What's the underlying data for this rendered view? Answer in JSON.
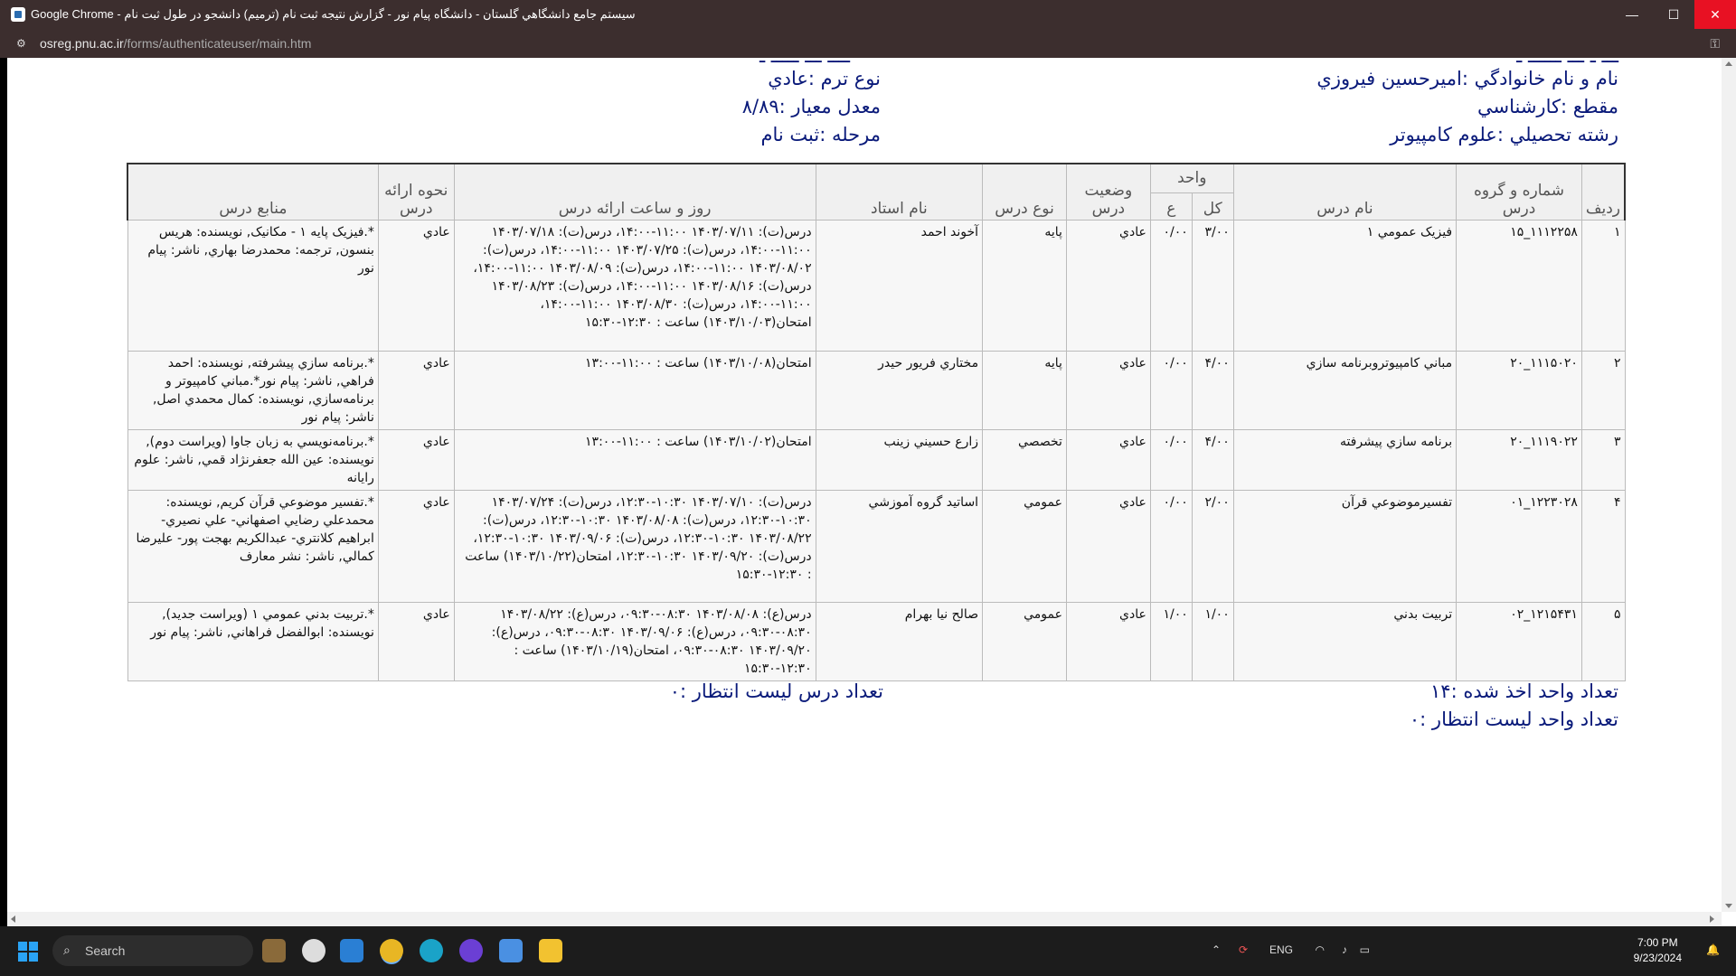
{
  "window": {
    "title": "Google Chrome - سيستم جامع دانشگاهي گلستان - دانشگاه پيام نور - گزارش نتيجه ثبت نام (ترميم) دانشجو در طول ثبت نام",
    "controls": {
      "minimize": "—",
      "maximize": "☐",
      "close": "✕"
    }
  },
  "address": {
    "domain": "osreg.pnu.ac.ir",
    "path": "/forms/authenticateuser/main.htm"
  },
  "student": {
    "name": "نام و نام خانوادگي :اميرحسين فيروزي",
    "level": "مقطع :کارشناسي",
    "major": "رشته تحصيلي :علوم کامپيوتر",
    "term_type": "نوع ترم :عادي",
    "gpa": "معدل معيار :۸/۸۹",
    "stage": "مرحله :ثبت نام"
  },
  "table": {
    "headers": {
      "row": "رديف",
      "code": "شماره و گروه درس",
      "name": "نام درس",
      "unit": "واحد",
      "unit_total": "کل",
      "unit_practical": "ع",
      "status": "وضعيت درس",
      "type": "نوع درس",
      "teacher": "نام استاد",
      "schedule": "روز و ساعت ارائه درس",
      "delivery": "نحوه ارائه درس",
      "sources": "منابع درس"
    },
    "rows": [
      {
        "row": "۱",
        "code": "۱۱۱۲۲۵۸_۱۵",
        "name": "فيزيک عمومي ۱",
        "unit_total": "۳/۰۰",
        "unit_practical": "۰/۰۰",
        "status": "عادي",
        "type": "پايه",
        "teacher": "آخوند احمد",
        "schedule": "درس(ت): ۱۴۰۳/۰۷/۱۱ ۱۱:۰۰-۱۴:۰۰، درس(ت): ۱۴۰۳/۰۷/۱۸ ۱۱:۰۰-۱۴:۰۰، درس(ت): ۱۴۰۳/۰۷/۲۵ ۱۱:۰۰-۱۴:۰۰، درس(ت): ۱۴۰۳/۰۸/۰۲ ۱۱:۰۰-۱۴:۰۰، درس(ت): ۱۴۰۳/۰۸/۰۹ ۱۱:۰۰-۱۴:۰۰، درس(ت): ۱۴۰۳/۰۸/۱۶ ۱۱:۰۰-۱۴:۰۰، درس(ت): ۱۴۰۳/۰۸/۲۳ ۱۱:۰۰-۱۴:۰۰، درس(ت): ۱۴۰۳/۰۸/۳۰ ۱۱:۰۰-۱۴:۰۰، امتحان(۱۴۰۳/۱۰/۰۳) ساعت : ۱۲:۳۰-۱۵:۳۰",
        "delivery": "عادي",
        "sources": "*.فيزيک پايه ۱ - مکانيک, نويسنده: هريس بنسون, ترجمه: محمدرضا بهاري, ناشر: پيام نور"
      },
      {
        "row": "۲",
        "code": "۱۱۱۵۰۲۰_۲۰",
        "name": "مباني کامپيوتروبرنامه سازي",
        "unit_total": "۴/۰۰",
        "unit_practical": "۰/۰۰",
        "status": "عادي",
        "type": "پايه",
        "teacher": "مختاري فريور حيدر",
        "schedule": "امتحان(۱۴۰۳/۱۰/۰۸) ساعت : ۱۱:۰۰-۱۳:۰۰",
        "delivery": "عادي",
        "sources": "*.برنامه سازي پيشرفته, نويسنده: احمد فراهي, ناشر: پيام نور*.مباني کامپيوتر و برنامه‌سازي, نويسنده: کمال محمدي اصل, ناشر: پيام نور"
      },
      {
        "row": "۳",
        "code": "۱۱۱۹۰۲۲_۲۰",
        "name": "برنامه سازي پيشرفته",
        "unit_total": "۴/۰۰",
        "unit_practical": "۰/۰۰",
        "status": "عادي",
        "type": "تخصصي",
        "teacher": "زارع حسيني زينب",
        "schedule": "امتحان(۱۴۰۳/۱۰/۰۲) ساعت : ۱۱:۰۰-۱۳:۰۰",
        "delivery": "عادي",
        "sources": "*.برنامه‌نويسي به زبان جاوا (ويراست دوم), نويسنده: عين الله جعفرنژاد قمي, ناشر: علوم رايانه"
      },
      {
        "row": "۴",
        "code": "۱۲۲۳۰۲۸_۰۱",
        "name": "تفسيرموضوعي قرآن",
        "unit_total": "۲/۰۰",
        "unit_practical": "۰/۰۰",
        "status": "عادي",
        "type": "عمومي",
        "teacher": "اساتيد گروه آموزشي",
        "schedule": "درس(ت): ۱۴۰۳/۰۷/۱۰ ۱۰:۳۰-۱۲:۳۰، درس(ت): ۱۴۰۳/۰۷/۲۴ ۱۰:۳۰-۱۲:۳۰، درس(ت): ۱۴۰۳/۰۸/۰۸ ۱۰:۳۰-۱۲:۳۰، درس(ت): ۱۴۰۳/۰۸/۲۲ ۱۰:۳۰-۱۲:۳۰، درس(ت): ۱۴۰۳/۰۹/۰۶ ۱۰:۳۰-۱۲:۳۰، درس(ت): ۱۴۰۳/۰۹/۲۰ ۱۰:۳۰-۱۲:۳۰، امتحان(۱۴۰۳/۱۰/۲۲) ساعت : ۱۲:۳۰-۱۵:۳۰",
        "delivery": "عادي",
        "sources": "*.تفسير موضوعي قرآن کريم, نويسنده: محمدعلي رضايي اصفهاني- علي نصيري- ابراهيم کلانتري- عبدالکريم بهجت پور- عليرضا کمالي, ناشر: نشر معارف"
      },
      {
        "row": "۵",
        "code": "۱۲۱۵۴۳۱_۰۲",
        "name": "تربيت بدني",
        "unit_total": "۱/۰۰",
        "unit_practical": "۱/۰۰",
        "status": "عادي",
        "type": "عمومي",
        "teacher": "صالح نيا بهرام",
        "schedule": "درس(ع): ۱۴۰۳/۰۸/۰۸ ۰۸:۳۰-۰۹:۳۰، درس(ع): ۱۴۰۳/۰۸/۲۲ ۰۸:۳۰-۰۹:۳۰، درس(ع): ۱۴۰۳/۰۹/۰۶ ۰۸:۳۰-۰۹:۳۰، درس(ع): ۱۴۰۳/۰۹/۲۰ ۰۸:۳۰-۰۹:۳۰، امتحان(۱۴۰۳/۱۰/۱۹) ساعت : ۱۲:۳۰-۱۵:۳۰",
        "delivery": "عادي",
        "sources": "*.تربيت بدني عمومي ۱ (ويراست جديد), نويسنده: ابوالفضل فراهاني, ناشر: پيام نور"
      }
    ]
  },
  "summary": {
    "units_taken": "تعداد واحد اخذ شده :۱۴",
    "waitlist_units": "تعداد واحد ليست انتظار :۰",
    "waitlist_courses": "تعداد درس ليست انتظار :۰"
  },
  "taskbar": {
    "search_label": "Search",
    "lang": "ENG",
    "time": "7:00 PM",
    "date": "9/23/2024"
  }
}
